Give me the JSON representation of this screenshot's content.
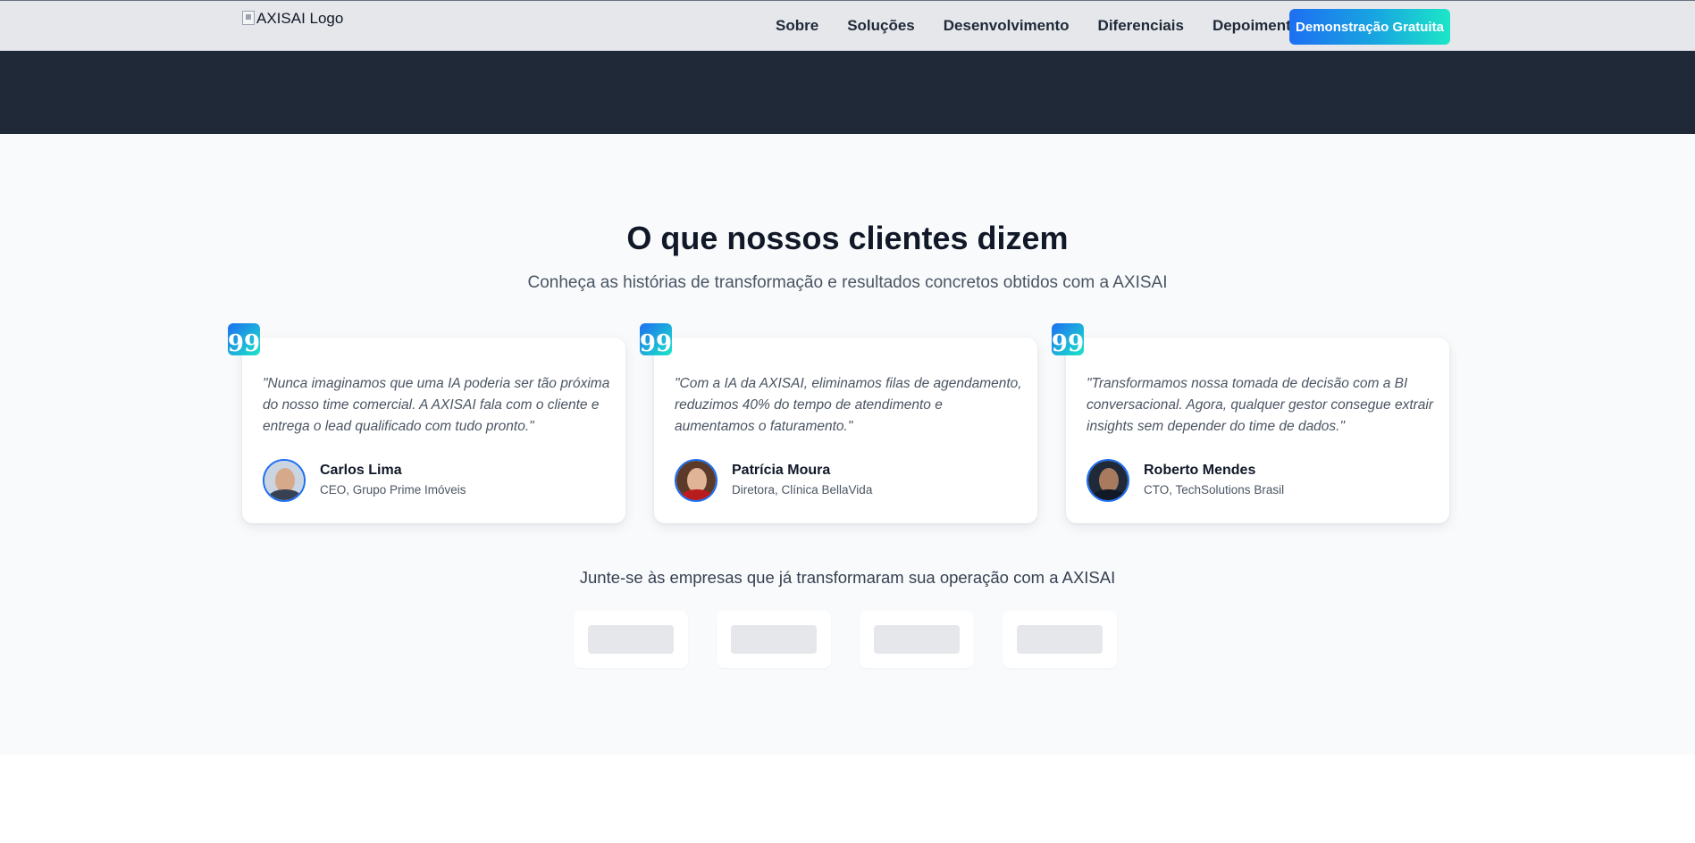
{
  "header": {
    "logo_alt": "AXISAI Logo",
    "nav": [
      "Sobre",
      "Soluções",
      "Desenvolvimento",
      "Diferenciais",
      "Depoimentos"
    ],
    "cta_label": "Demonstração Gratuita",
    "accent_gradient": [
      "#1d6ff2",
      "#1ce6c8"
    ]
  },
  "testimonials": {
    "title": "O que nossos clientes dizem",
    "subtitle": "Conheça as histórias de transformação e resultados concretos obtidos com a AXISAI",
    "items": [
      {
        "quote": "\"Nunca imaginamos que uma IA poderia ser tão próxima do nosso time comercial. A AXISAI fala com o cliente e entrega o lead qualificado com tudo pronto.\"",
        "name": "Carlos Lima",
        "role": "CEO, Grupo Prime Imóveis",
        "icon": "quote-icon"
      },
      {
        "quote": "\"Com a IA da AXISAI, eliminamos filas de agendamento, reduzimos 40% do tempo de atendimento e aumentamos o faturamento.\"",
        "name": "Patrícia Moura",
        "role": "Diretora, Clínica BellaVida",
        "icon": "quote-icon"
      },
      {
        "quote": "\"Transformamos nossa tomada de decisão com a BI conversacional. Agora, qualquer gestor consegue extrair insights sem depender do time de dados.\"",
        "name": "Roberto Mendes",
        "role": "CTO, TechSolutions Brasil",
        "icon": "quote-icon"
      }
    ],
    "quote_glyph": "99"
  },
  "clients": {
    "join_text": "Junte-se às empresas que já transformaram sua operação com a AXISAI",
    "logo_placeholders": 4
  }
}
